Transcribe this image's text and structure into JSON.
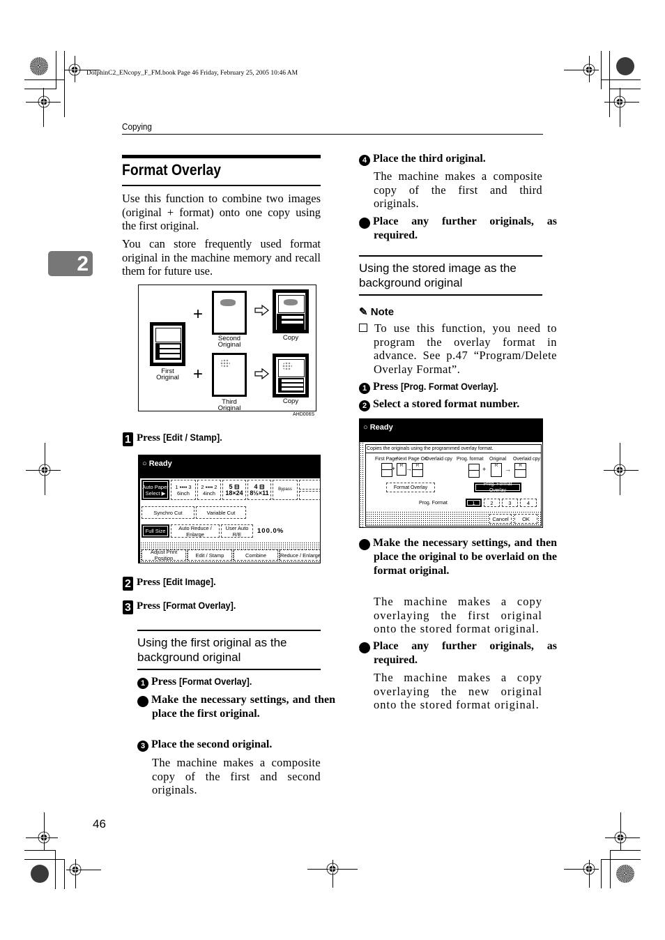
{
  "book_header": "DolphinC2_ENcopy_F_FM.book  Page 46  Friday, February 25, 2005  10:46 AM",
  "running_header": "Copying",
  "chapter_tab": "2",
  "page_number": "46",
  "section": {
    "title": "Format Overlay",
    "intro": [
      "Use this function to combine two images (original + format) onto one copy using the first original.",
      "You can store frequently used format original in the machine memory and recall them for future use."
    ]
  },
  "figure": {
    "labels": {
      "first_original": [
        "First",
        "Original"
      ],
      "second_original": [
        "Second",
        "Original"
      ],
      "third_original": [
        "Third",
        "Original"
      ],
      "copy_top": "Copy",
      "copy_bottom": "Copy"
    },
    "code": "AHD006S",
    "icons": [
      "plus-icon",
      "arrow-right-icon"
    ]
  },
  "steps": [
    {
      "num": "1",
      "prefix": "Press ",
      "key": "[Edit / Stamp]."
    },
    {
      "num": "2",
      "prefix": "Press ",
      "key": "[Edit Image]."
    },
    {
      "num": "3",
      "prefix": "Press ",
      "key": "[Format Overlay]."
    }
  ],
  "screen1": {
    "status": "Ready",
    "paper_buttons": [
      {
        "label": "Auto Paper Select ▶",
        "selected": true
      },
      {
        "label": "1 ▪▪▪▪ 3 6inch",
        "selected": false
      },
      {
        "label": "2 ▪▪▪▪ 2 4inch",
        "selected": false
      },
      {
        "label": "5 ⊟ 18×24",
        "selected": false
      },
      {
        "label": "4 ⊟ 8½×11",
        "selected": false
      },
      {
        "label": "Bypass",
        "selected": false
      }
    ],
    "cut_buttons": [
      "Synchro Cut",
      "Variable Cut"
    ],
    "size_buttons": [
      {
        "label": "Full Size",
        "selected": true
      },
      {
        "label": "Auto Reduce / Enlarge",
        "selected": false
      },
      {
        "label": "User Auto R/E",
        "selected": false
      }
    ],
    "ratio": "100.0%",
    "bottom_tabs": [
      "Adjust Print Position",
      "Edit / Stamp",
      "Combine",
      "Reduce / Enlarge"
    ]
  },
  "subsection1": {
    "title": "Using the first original as the background original",
    "steps": [
      {
        "num": "1",
        "prefix": "Press ",
        "key": "[Format Overlay].",
        "desc": ""
      },
      {
        "num": "2",
        "text": "Make the necessary settings, and then place the first original.",
        "desc": ""
      },
      {
        "num": "3",
        "text": "Place the second original.",
        "desc": "The machine makes a composite copy of the first and second originals."
      },
      {
        "num": "4",
        "text": "Place the third original.",
        "desc": "The machine makes a composite copy of the first and third originals."
      },
      {
        "num": "5",
        "text": "Place any further originals, as required.",
        "desc": ""
      }
    ]
  },
  "subsection2": {
    "title": "Using the stored image as the background original",
    "note_title": "Note",
    "note_text": "To use this function, you need to program the overlay format in advance. See p.47 “Program/Delete Overlay Format”.",
    "steps": [
      {
        "num": "1",
        "prefix": "Press ",
        "key": "[Prog. Format Overlay].",
        "desc": ""
      },
      {
        "num": "2",
        "text": "Select a stored format number.",
        "desc": ""
      },
      {
        "num": "3",
        "text": "Make the necessary settings, and then place the original to be overlaid on the format original.",
        "desc": "The machine makes a copy overlaying the first original onto the stored format original."
      },
      {
        "num": "4",
        "text": "Place any further originals, as required.",
        "desc": "The machine makes a copy overlaying the new original onto the stored format original."
      }
    ]
  },
  "screen2": {
    "status": "Ready",
    "instruction": "Copies the originals using the programmed overlay format.",
    "left_labels": [
      "First Page",
      "Next Page On",
      "Overlaid cpy"
    ],
    "right_labels": [
      "Prog. format",
      "Original",
      "Overlaid cpy"
    ],
    "mode_buttons": [
      {
        "label": "Format Overlay",
        "selected": false
      },
      {
        "label": "Prog. Format Overlay",
        "selected": true
      }
    ],
    "prog_format_label": "Prog. Format",
    "format_numbers": [
      {
        "label": "1",
        "selected": true
      },
      {
        "label": "2",
        "selected": false
      },
      {
        "label": "3",
        "selected": false
      },
      {
        "label": "4",
        "selected": false
      }
    ],
    "cancel_label": "Cancel",
    "ok_label": "OK"
  }
}
